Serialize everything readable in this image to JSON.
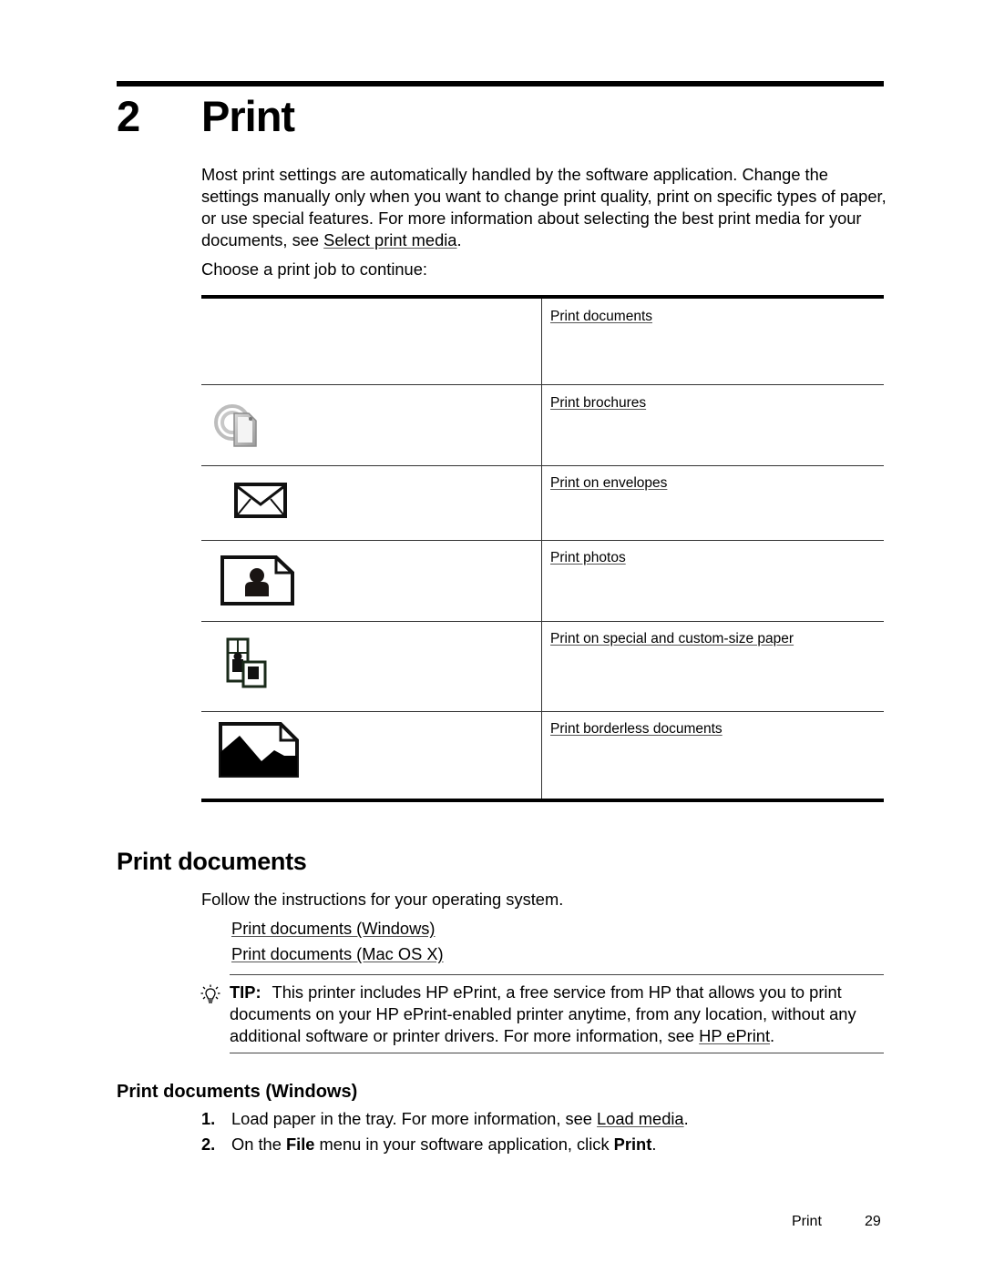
{
  "chapter": {
    "number": "2",
    "title": "Print"
  },
  "intro": {
    "text_before_link": "Most print settings are automatically handled by the software application. Change the settings manually only when you want to change print quality, print on specific types of paper, or use special features. For more information about selecting the best print media for your documents, see ",
    "link": "Select print media",
    "text_after_link": "."
  },
  "choose_prompt": "Choose a print job to continue:",
  "print_jobs": [
    {
      "icon": "none",
      "label": "Print documents"
    },
    {
      "icon": "brochure-icon",
      "label": "Print brochures"
    },
    {
      "icon": "envelope-icon",
      "label": "Print on envelopes"
    },
    {
      "icon": "photo-icon",
      "label": "Print photos"
    },
    {
      "icon": "custom-size-paper-icon",
      "label": "Print on special and custom-size paper"
    },
    {
      "icon": "borderless-icon",
      "label": "Print borderless documents"
    }
  ],
  "section": {
    "heading": "Print documents",
    "follow_text": "Follow the instructions for your operating system.",
    "os_links": [
      "Print documents (Windows)",
      "Print documents (Mac OS X)"
    ]
  },
  "tip": {
    "icon": "lightbulb-icon",
    "label": "TIP:",
    "text_before_link": "This printer includes HP ePrint, a free service from HP that allows you to print documents on your HP ePrint-enabled printer anytime, from any location, without any additional software or printer drivers. For more information, see ",
    "link": "HP ePrint",
    "text_after_link": "."
  },
  "windows": {
    "heading": "Print documents (Windows)",
    "steps": [
      {
        "number": "1.",
        "text_before_link": "Load paper in the tray. For more information, see ",
        "link": "Load media",
        "text_after_link": "."
      },
      {
        "number": "2.",
        "part1": "On the ",
        "bold1": "File",
        "part2": " menu in your software application, click ",
        "bold2": "Print",
        "part3": "."
      }
    ]
  },
  "footer": {
    "section": "Print",
    "page_number": "29"
  }
}
